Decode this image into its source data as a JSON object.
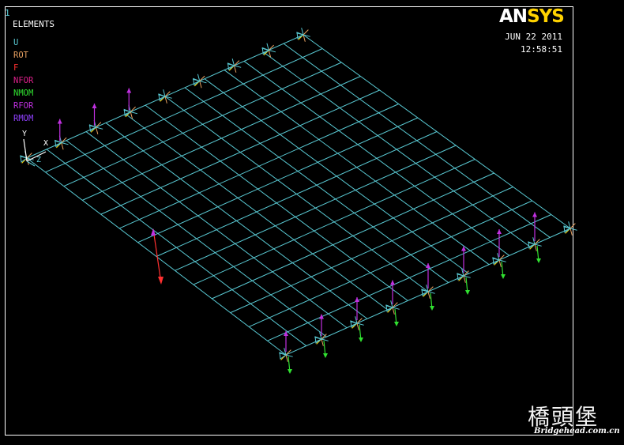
{
  "window": {
    "number": "1",
    "title": "ELEMENTS"
  },
  "logo": {
    "part1": "AN",
    "part2": "SYS"
  },
  "timestamp": {
    "date": "JUN 22 2011",
    "time": "12:58:51"
  },
  "legend": [
    {
      "label": "U",
      "color": "#59c9d3"
    },
    {
      "label": "ROT",
      "color": "#e8a060"
    },
    {
      "label": "F",
      "color": "#ff3030"
    },
    {
      "label": "NFOR",
      "color": "#e0208c"
    },
    {
      "label": "NMOM",
      "color": "#30e030"
    },
    {
      "label": "RFOR",
      "color": "#c030e0"
    },
    {
      "label": "RMOM",
      "color": "#9040ff"
    }
  ],
  "triad": {
    "y": "Y",
    "x": "X",
    "z": "Z"
  },
  "mesh": {
    "color": "#59c9d3",
    "divisions_long": 14,
    "divisions_short": 14
  },
  "watermark": {
    "text": "橋頭堡",
    "url": "Bridgehead.com.cn"
  }
}
